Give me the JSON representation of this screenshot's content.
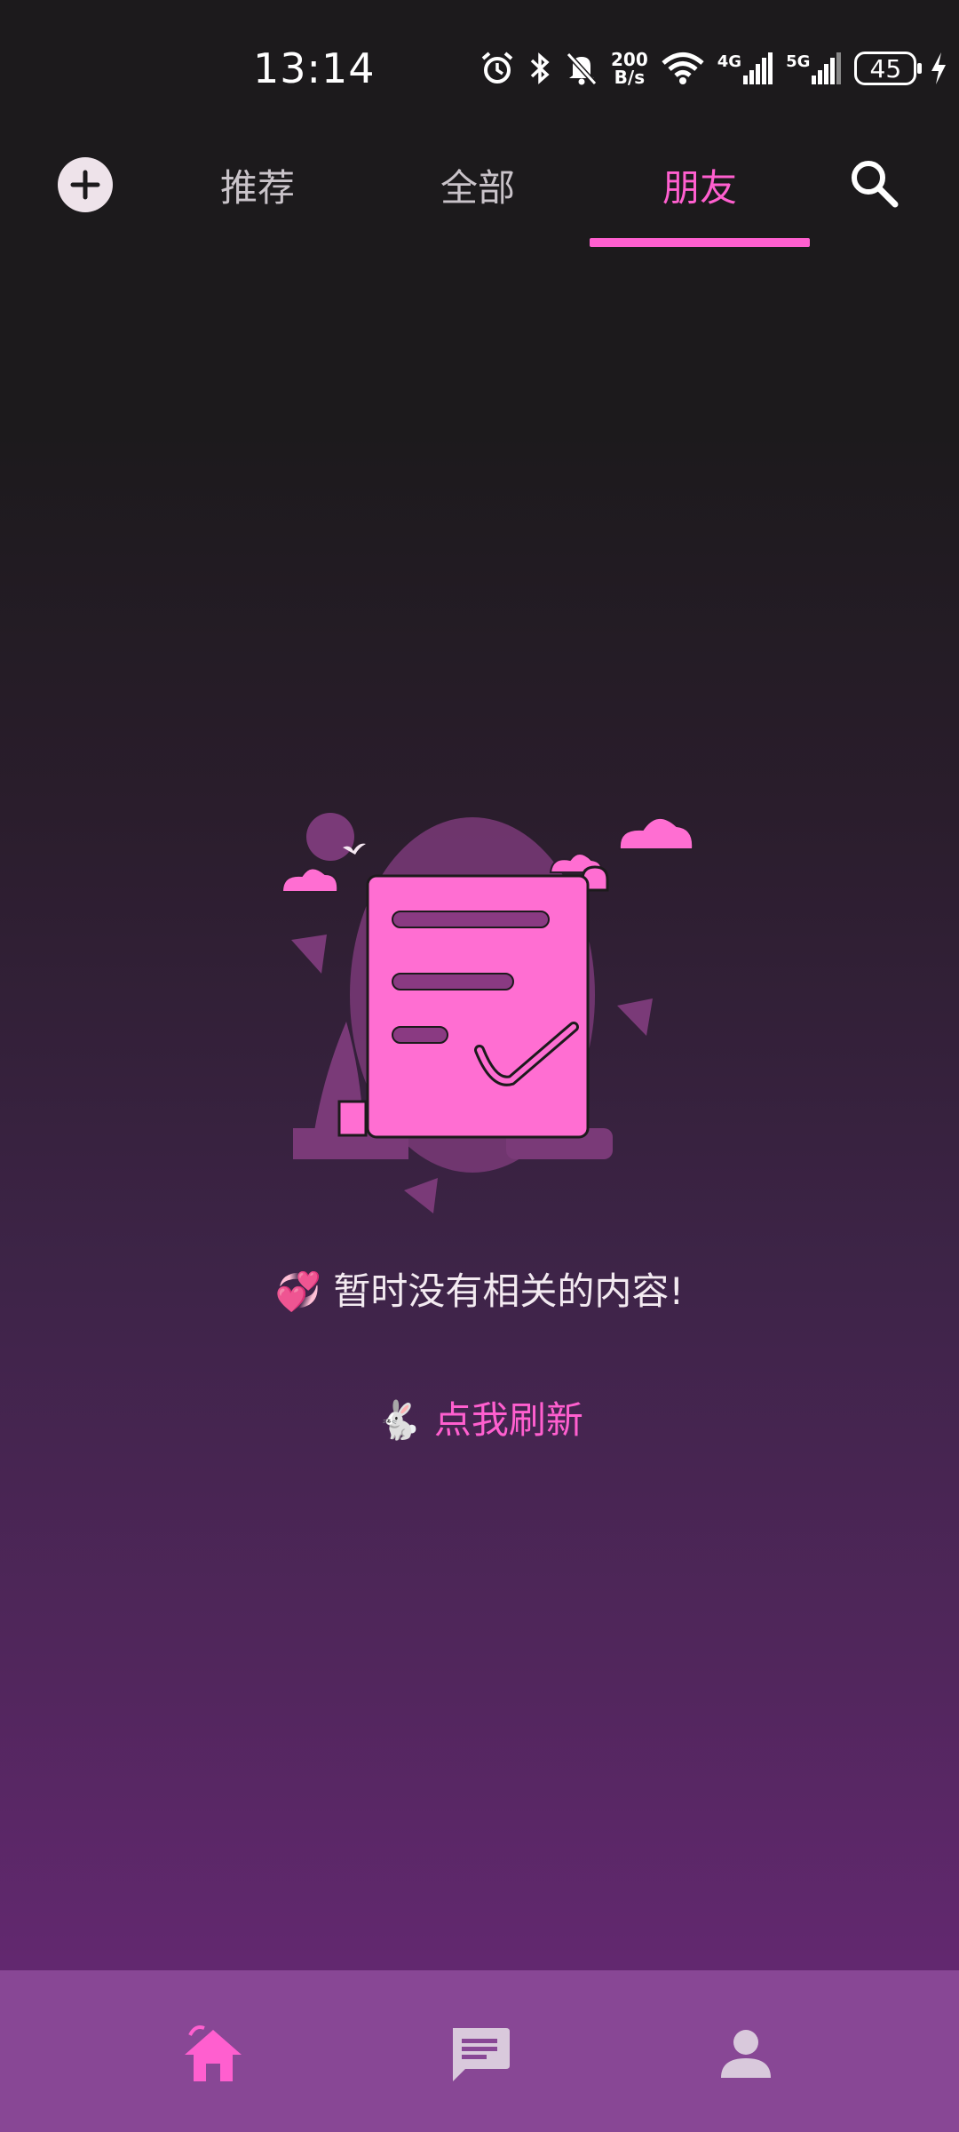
{
  "status_bar": {
    "time": "13:14",
    "net_speed_top": "200",
    "net_speed_bottom": "B/s",
    "network_4g": "4G",
    "network_5g": "5G",
    "battery": "45",
    "icons": [
      "alarm-icon",
      "bluetooth-icon",
      "mute-icon",
      "wifi-icon",
      "signal-icon",
      "charging-icon"
    ]
  },
  "top_tabs": {
    "items": [
      {
        "label": "推荐",
        "active": false
      },
      {
        "label": "全部",
        "active": false
      },
      {
        "label": "朋友",
        "active": true
      }
    ],
    "accent": "#ff5fcf"
  },
  "empty_state": {
    "message_emoji": "💞",
    "message": "暂时没有相关的内容!",
    "refresh_emoji": "🐇",
    "refresh_label": "点我刷新"
  },
  "bottom_nav": {
    "items": [
      {
        "icon": "home-icon",
        "active": true
      },
      {
        "icon": "message-icon",
        "active": false
      },
      {
        "icon": "profile-icon",
        "active": false
      }
    ]
  },
  "colors": {
    "accent": "#ff5fcf",
    "nav_bg": "#884795",
    "bg_top": "#1c1a1c",
    "bg_bottom": "#66296f"
  }
}
